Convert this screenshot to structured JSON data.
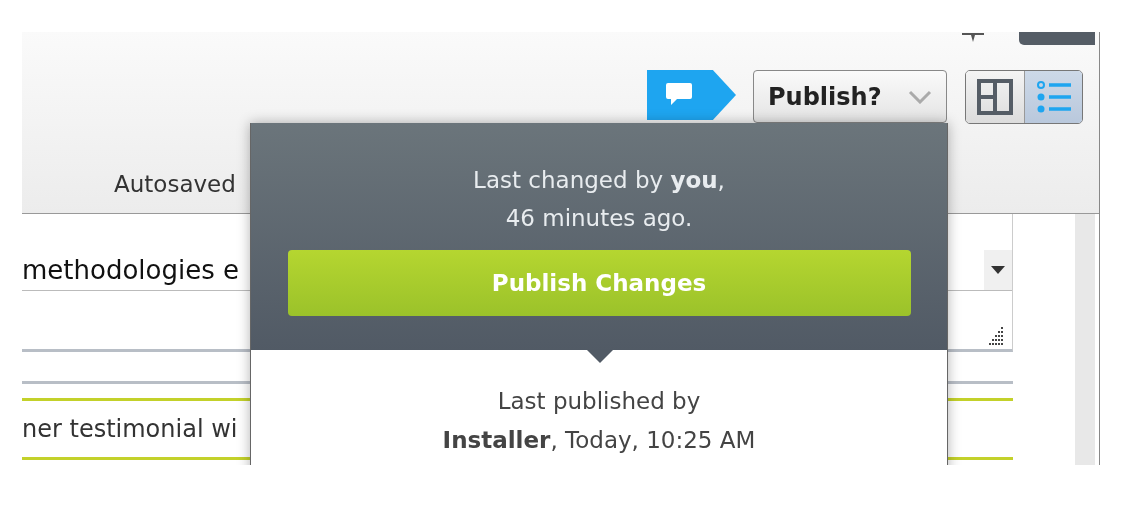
{
  "header": {
    "status": "Autosaved",
    "publish_menu": {
      "label": "Publish?",
      "expanded": true
    },
    "view_toggle": [
      {
        "kind": "layout",
        "selected": false
      },
      {
        "kind": "list",
        "selected": true
      }
    ]
  },
  "editor": {
    "field_value": "methodologies e",
    "list_item": "ner testimonial wi"
  },
  "popup": {
    "changed": [
      "Last changed by **you**,",
      "46 minutes ago."
    ],
    "publish_button": "Publish Changes",
    "published": [
      "Last published by",
      "**Installer**, Today, 10:25 AM"
    ]
  }
}
